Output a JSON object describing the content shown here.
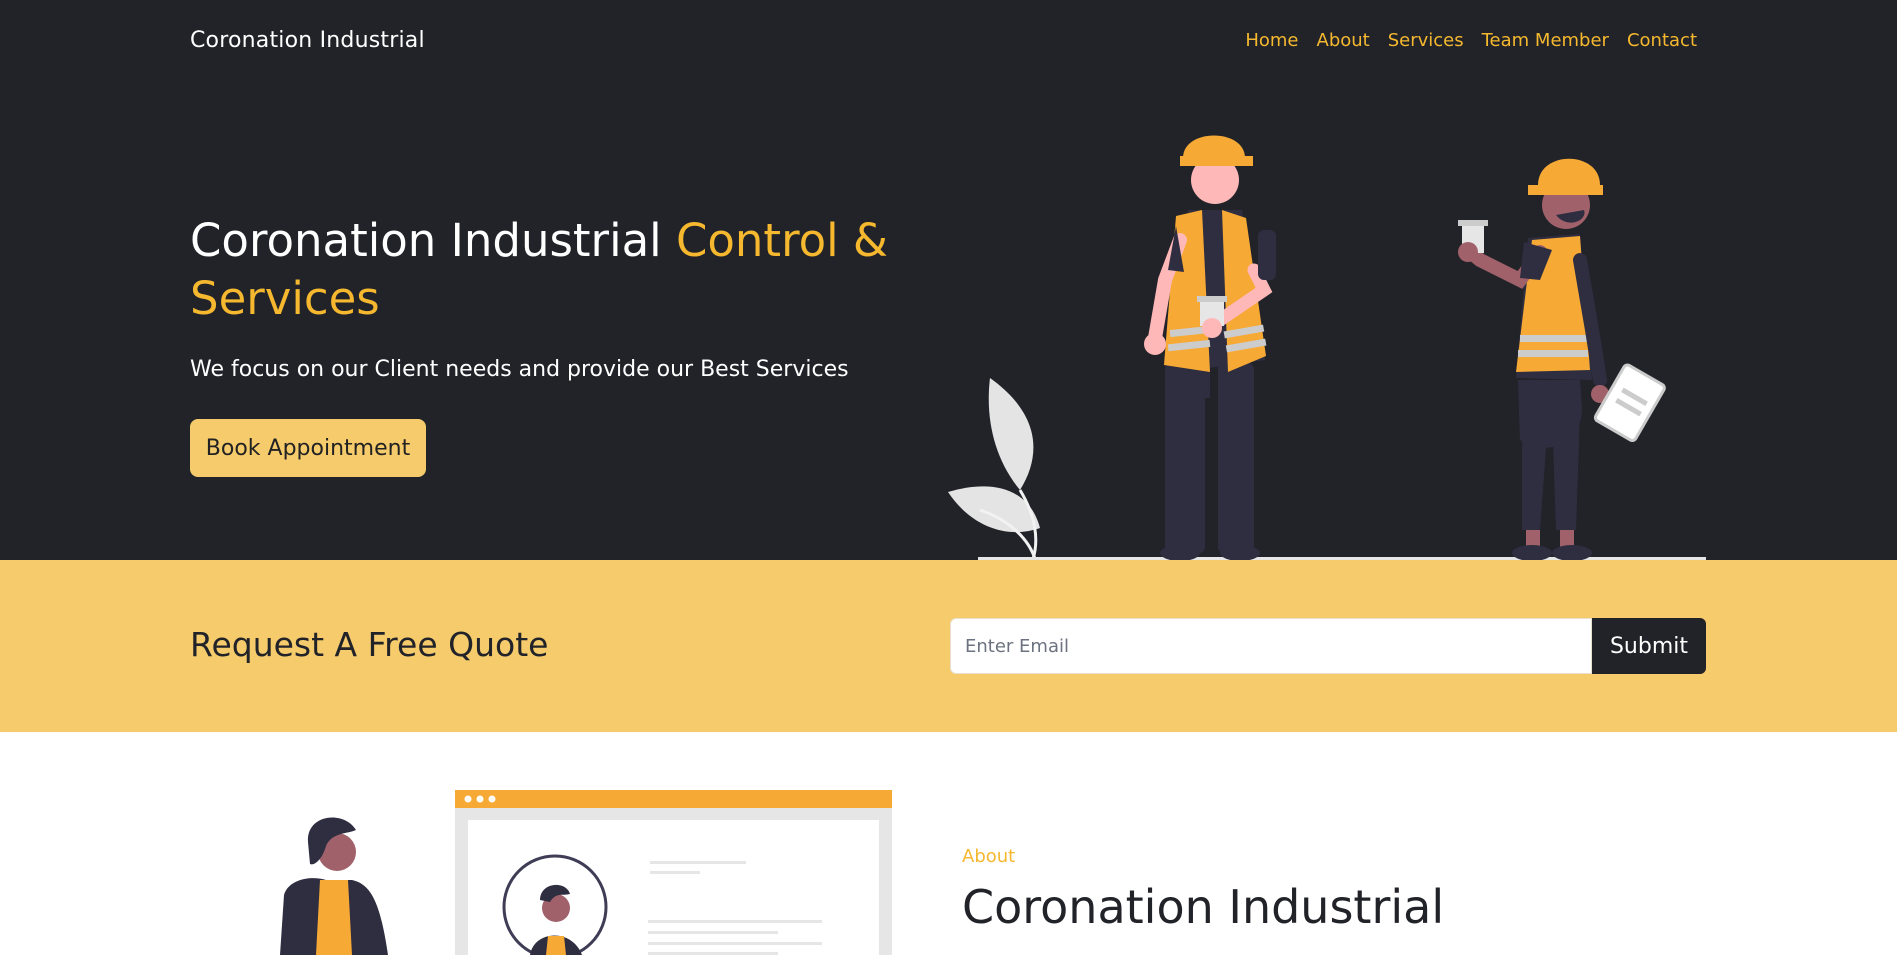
{
  "brand": "Coronation Industrial",
  "nav": [
    "Home",
    "About",
    "Services",
    "Team Member",
    "Contact"
  ],
  "hero": {
    "title_white": "Coronation Industrial ",
    "title_accent": "Control & Services",
    "subtitle": "We focus on our Client needs and provide our Best Services",
    "cta": "Book Appointment"
  },
  "quote": {
    "title": "Request A Free Quote",
    "email_placeholder": "Enter Email",
    "submit": "Submit"
  },
  "about": {
    "label": "About",
    "title": "Coronation Industrial"
  },
  "colors": {
    "dark": "#212329",
    "accent": "#f5b82e",
    "band": "#f5cb6c",
    "white": "#ffffff"
  }
}
